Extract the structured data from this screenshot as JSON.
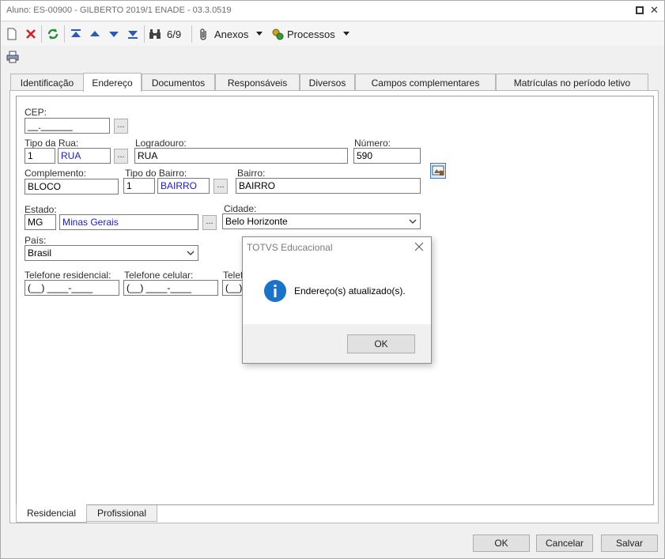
{
  "window": {
    "title": "Aluno: ES-00900 - GILBERTO 2019/1 ENADE - 03.3.0519"
  },
  "toolbar": {
    "record_position": "6/9",
    "anexos_label": "Anexos",
    "processos_label": "Processos"
  },
  "tabs": [
    {
      "label": "Identificação"
    },
    {
      "label": "Endereço"
    },
    {
      "label": "Documentos"
    },
    {
      "label": "Responsáveis"
    },
    {
      "label": "Diversos"
    },
    {
      "label": "Campos complementares"
    },
    {
      "label": "Matrículas no período letivo"
    }
  ],
  "form": {
    "cep": {
      "label": "CEP:",
      "value": "__.______"
    },
    "tipo_rua": {
      "label": "Tipo da Rua:",
      "code": "1",
      "name": "RUA"
    },
    "logradouro": {
      "label": "Logradouro:",
      "value": "RUA"
    },
    "numero": {
      "label": "Número:",
      "value": "590"
    },
    "complemento": {
      "label": "Complemento:",
      "value": "BLOCO"
    },
    "tipo_bairro": {
      "label": "Tipo do Bairro:",
      "code": "1",
      "name": "BAIRRO"
    },
    "bairro": {
      "label": "Bairro:",
      "value": "BAIRRO"
    },
    "estado": {
      "label": "Estado:",
      "code": "MG",
      "name": "Minas Gerais"
    },
    "cidade": {
      "label": "Cidade:",
      "value": "Belo Horizonte"
    },
    "pais": {
      "label": "País:",
      "value": "Brasil"
    },
    "tel_residencial": {
      "label": "Telefone residencial:",
      "value": "(__) ____-____"
    },
    "tel_celular": {
      "label": "Telefone celular:",
      "value": "(__) ____-____"
    },
    "tel_comercial": {
      "label": "Telef",
      "value": "(__) "
    }
  },
  "browse_label": "...",
  "bottom_tabs": [
    {
      "label": "Residencial"
    },
    {
      "label": "Profissional"
    }
  ],
  "footer": {
    "ok": "OK",
    "cancelar": "Cancelar",
    "salvar": "Salvar"
  },
  "dialog": {
    "title": "TOTVS Educacional",
    "message": "Endereço(s) atualizado(s).",
    "ok": "OK"
  },
  "colors": {
    "link_blue": "#1a1ac8",
    "info_icon": "#1a73c8"
  }
}
